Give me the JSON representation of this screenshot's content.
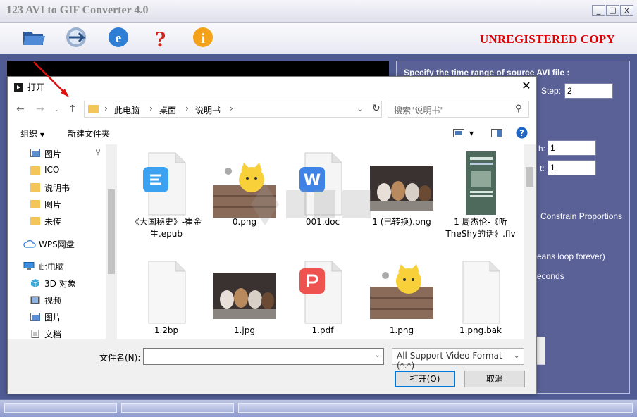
{
  "app": {
    "title": "123 AVI to GIF Converter 4.0",
    "window_controls": [
      "_",
      "□",
      "x"
    ],
    "toolbar_icons": [
      "folder-open-icon",
      "convert-icon",
      "web-icon",
      "help-icon",
      "info-icon"
    ],
    "unregistered": "UNREGISTERED COPY"
  },
  "right_panel": {
    "heading": "Specify the time range of source AVI file :",
    "step_label": "Step:",
    "step_value": "2",
    "field1_label": "h:",
    "field1_value": "1",
    "field2_label": "t:",
    "field2_value": "1",
    "constrain": "Constrain Proportions",
    "loop_note": "eans loop forever)",
    "seconds": "econds"
  },
  "dialog": {
    "title": "打开",
    "close": "✕",
    "breadcrumb": [
      "此电脑",
      "桌面",
      "说明书"
    ],
    "search_placeholder": "搜索\"说明书\"",
    "organize": "组织",
    "new_folder": "新建文件夹",
    "sidebar": [
      {
        "label": "图片",
        "icon": "pictures-icon"
      },
      {
        "label": "ICO",
        "icon": "folder-icon"
      },
      {
        "label": "说明书",
        "icon": "folder-icon"
      },
      {
        "label": "图片",
        "icon": "folder-icon"
      },
      {
        "label": "未传",
        "icon": "folder-icon"
      },
      {
        "label": "WPS网盘",
        "icon": "cloud-icon"
      },
      {
        "label": "此电脑",
        "icon": "computer-icon"
      },
      {
        "label": "3D 对象",
        "icon": "cube-icon"
      },
      {
        "label": "视频",
        "icon": "video-icon"
      },
      {
        "label": "图片",
        "icon": "pictures-icon"
      },
      {
        "label": "文档",
        "icon": "document-icon"
      }
    ],
    "files": [
      {
        "name": "《大国秘史》-崔金生.epub",
        "icon": "epub-icon"
      },
      {
        "name": "0.png",
        "icon": "cartoon-cat-thumbnail"
      },
      {
        "name": "001.doc",
        "icon": "wps-doc-icon"
      },
      {
        "name": "1 (已转换).png",
        "icon": "puppies-thumbnail"
      },
      {
        "name": "1 周杰伦-《听TheShy的话》.flv",
        "icon": "video-thumbnail"
      },
      {
        "name": "1.2bp",
        "icon": "blank-file-icon"
      },
      {
        "name": "1.jpg",
        "icon": "puppies-thumbnail"
      },
      {
        "name": "1.pdf",
        "icon": "pdf-icon"
      },
      {
        "name": "1.png",
        "icon": "cartoon-cat-thumbnail"
      },
      {
        "name": "1.png.bak",
        "icon": "blank-file-icon"
      }
    ],
    "filename_label": "文件名(N):",
    "filename_value": "",
    "filter": "All Support Video Format (*.*)",
    "open_button": "打开(O)",
    "cancel_button": "取消"
  }
}
